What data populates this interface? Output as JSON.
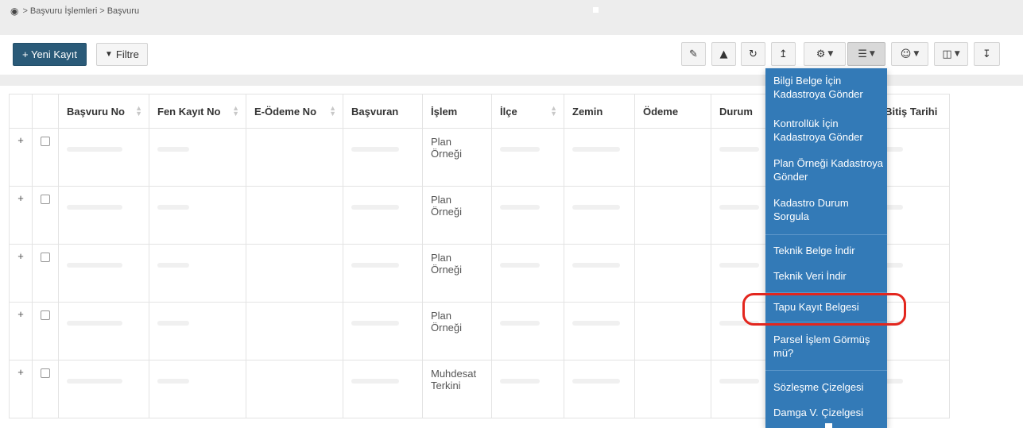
{
  "breadcrumb": {
    "icon": "dashboard-icon",
    "items": [
      "Başvuru İşlemleri",
      "Başvuru"
    ]
  },
  "toolbar": {
    "new_label": "+ Yeni Kayıt",
    "filter_label": "Filtre",
    "tools": [
      "edit-icon",
      "delete-icon",
      "refresh-icon",
      "upload-icon",
      "settings-icon",
      "list-menu-icon",
      "users-icon",
      "columns-icon",
      "download-icon"
    ]
  },
  "table": {
    "headers": [
      "Başvuru No",
      "Fen Kayıt No",
      "E-Ödeme No",
      "Başvuran",
      "İşlem",
      "İlçe",
      "Zemin",
      "Ödeme",
      "Durum",
      "",
      "Bekleme Bitiş Tarihi"
    ],
    "rows": [
      {
        "islem_line1": "Plan",
        "islem_line2": "Örneği"
      },
      {
        "islem_line1": "Plan",
        "islem_line2": "Örneği"
      },
      {
        "islem_line1": "Plan",
        "islem_line2": "Örneği"
      },
      {
        "islem_line1": "Plan",
        "islem_line2": "Örneği"
      },
      {
        "islem_line1": "Muhdesat",
        "islem_line2": "Terkini"
      }
    ]
  },
  "menu": {
    "items": [
      "Bilgi Belge İçin Kadastroya Gönder",
      "Kontrollük İçin Kadastroya Gönder",
      "Plan Örneği Kadastroya Gönder",
      "Kadastro Durum Sorgula",
      "Teknik Belge İndir",
      "Teknik Veri İndir",
      "Tapu Kayıt Belgesi",
      "Parsel İşlem Görmüş mü?",
      "Sözleşme Çizelgesi",
      "Damga V. Çizelgesi"
    ],
    "highlight_color": "#e3261e",
    "menu_color": "#337ab7"
  }
}
